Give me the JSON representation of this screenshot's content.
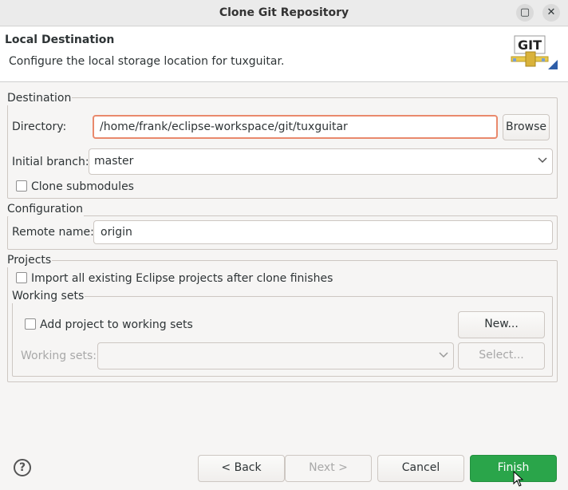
{
  "window": {
    "title": "Clone Git Repository",
    "maximize_symbol": "▢",
    "close_symbol": "✕"
  },
  "header": {
    "title": "Local Destination",
    "description": "Configure the local storage location for tuxguitar.",
    "logo_text": "GIT"
  },
  "destination": {
    "legend": "Destination",
    "directory_label": "Directory:",
    "directory_value": "/home/frank/eclipse-workspace/git/tuxguitar",
    "browse_label": "Browse",
    "branch_label": "Initial branch:",
    "branch_value": "master",
    "clone_submodules_label": "Clone submodules"
  },
  "configuration": {
    "legend": "Configuration",
    "remote_label": "Remote name:",
    "remote_value": "origin"
  },
  "projects": {
    "legend": "Projects",
    "import_label": "Import all existing Eclipse projects after clone finishes",
    "working_sets": {
      "legend": "Working sets",
      "add_label": "Add project to working sets",
      "new_label": "New...",
      "sets_label": "Working sets:",
      "sets_value": "",
      "select_label": "Select..."
    }
  },
  "footer": {
    "help_symbol": "?",
    "back_label": "< Back",
    "next_label": "Next >",
    "cancel_label": "Cancel",
    "finish_label": "Finish"
  },
  "colors": {
    "accent_focus": "#e9896c",
    "finish_green": "#2aa54a"
  }
}
